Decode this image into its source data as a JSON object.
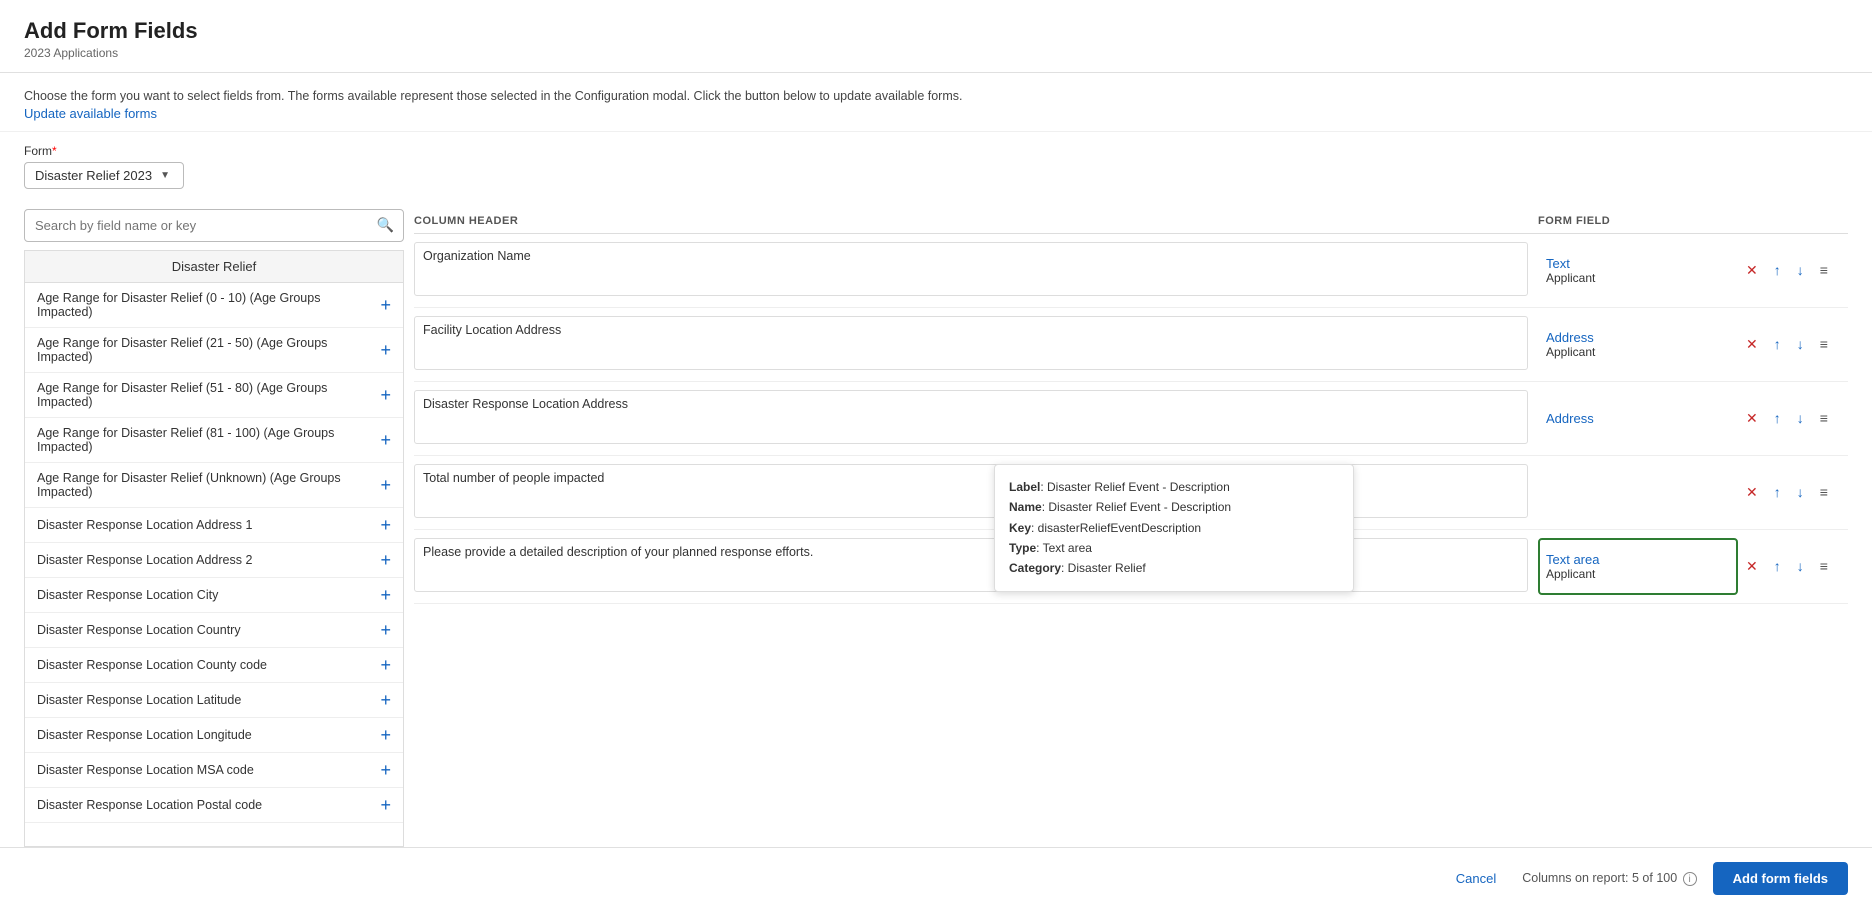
{
  "header": {
    "title": "Add Form Fields",
    "subtitle": "2023 Applications"
  },
  "description": {
    "text": "Choose the form you want to select fields from. The forms available represent those selected in the Configuration modal. Click the button below to update available forms.",
    "link_text": "Update available forms"
  },
  "form_select": {
    "label": "Form",
    "required": true,
    "selected_value": "Disaster Relief 2023"
  },
  "search": {
    "placeholder": "Search by field name or key"
  },
  "field_list": {
    "header": "Disaster Relief",
    "items": [
      "Age Range for Disaster Relief (0 - 10) (Age Groups Impacted)",
      "Age Range for Disaster Relief (21 - 50) (Age Groups Impacted)",
      "Age Range for Disaster Relief (51 - 80) (Age Groups Impacted)",
      "Age Range for Disaster Relief (81 - 100) (Age Groups Impacted)",
      "Age Range for Disaster Relief (Unknown) (Age Groups Impacted)",
      "Disaster Response Location Address 1",
      "Disaster Response Location Address 2",
      "Disaster Response Location City",
      "Disaster Response Location Country",
      "Disaster Response Location County code",
      "Disaster Response Location Latitude",
      "Disaster Response Location Longitude",
      "Disaster Response Location MSA code",
      "Disaster Response Location Postal code"
    ]
  },
  "table": {
    "col_header": "COLUMN HEADER",
    "col_form_field": "FORM FIELD",
    "rows": [
      {
        "column_header_value": "Organization Name",
        "field_type": "Text",
        "field_sub": "Applicant",
        "highlighted": false
      },
      {
        "column_header_value": "Facility Location Address",
        "field_type": "Address",
        "field_sub": "Applicant",
        "highlighted": false
      },
      {
        "column_header_value": "Disaster Response Location Address",
        "field_type": "Address",
        "field_sub": "",
        "highlighted": false
      },
      {
        "column_header_value": "Total number of people impacted",
        "field_type": "",
        "field_sub": "",
        "highlighted": false
      },
      {
        "column_header_value": "Please provide a detailed description of your planned response efforts.",
        "field_type": "Text area",
        "field_sub": "Applicant",
        "highlighted": true
      }
    ]
  },
  "tooltip": {
    "label_text": "Label: Disaster Relief Event - Description",
    "name_text": "Name: Disaster Relief Event - Description",
    "key_text": "Key: disasterReliefEventDescription",
    "type_text": "Type: Text area",
    "category_text": "Category: Disaster Relief"
  },
  "footer": {
    "cancel_label": "Cancel",
    "columns_info": "Columns on report: 5 of 100",
    "add_button_label": "Add form fields"
  }
}
